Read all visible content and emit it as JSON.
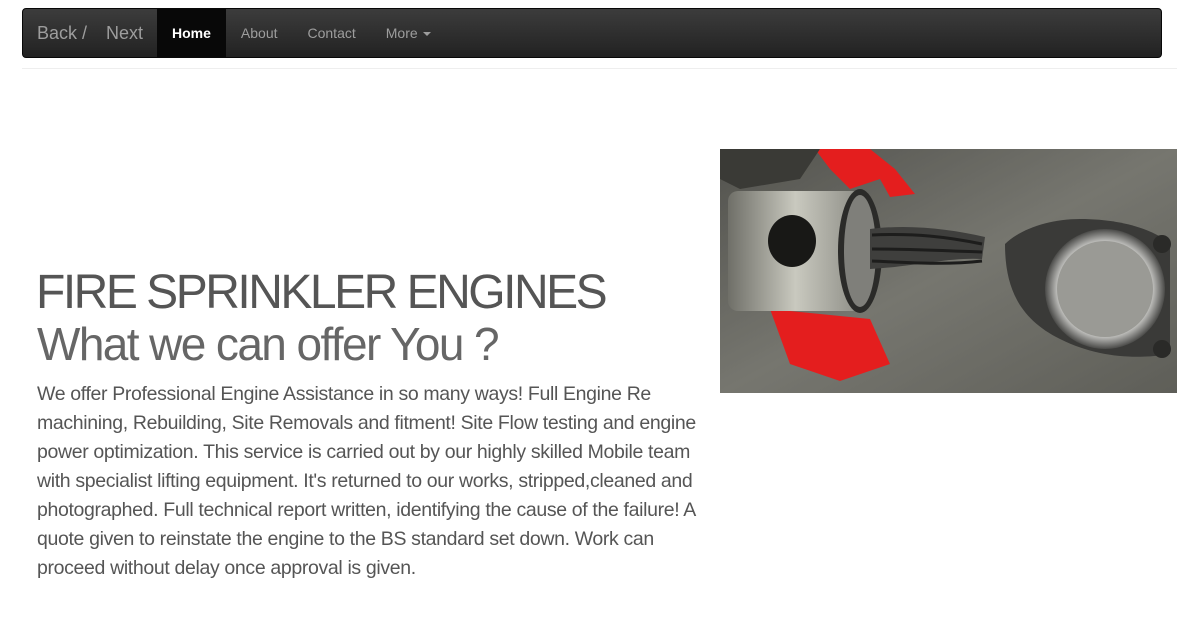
{
  "navbar": {
    "brand_back": "Back /",
    "brand_next": "Next",
    "items": [
      {
        "label": "Home"
      },
      {
        "label": "About"
      },
      {
        "label": "Contact"
      },
      {
        "label": "More"
      }
    ]
  },
  "hero": {
    "title": "FIRE SPRINKLER ENGINES",
    "subtitle": "What we can offer You ?",
    "description": "We offer Professional Engine Assistance in so many ways! Full Engine Re machining, Rebuilding, Site Removals and fitment! Site Flow testing and engine power optimization. This service is carried out by our highly skilled Mobile team with specialist lifting equipment. It's returned to our works, stripped,cleaned and photographed. Full technical report written, identifying the cause of the failure! A quote given to reinstate the engine to the BS standard set down. Work can proceed without delay once approval is given."
  },
  "colors": {
    "navbar_bg": "#222222",
    "nav_text": "#9d9d9d",
    "nav_active_bg": "#080808",
    "accent_red": "#e41e1e"
  }
}
